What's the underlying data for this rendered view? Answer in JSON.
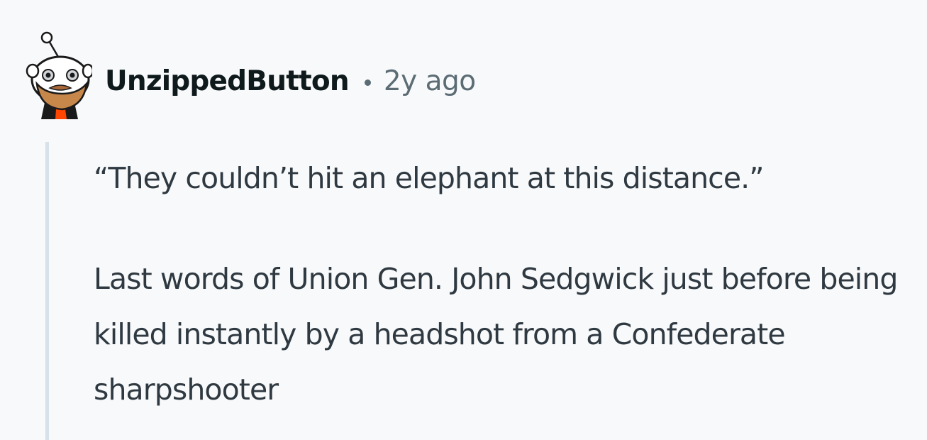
{
  "comment": {
    "author": "UnzippedButton",
    "separator": "•",
    "timestamp": "2y ago",
    "avatar_icon": "snoo-avatar-icon",
    "paragraphs": [
      "“They couldn’t hit an elephant at this distance.”",
      "Last words of Union Gen. John Sedgwick just before being killed instantly by a headshot from a Confederate sharpshooter"
    ]
  },
  "colors": {
    "background": "#f8f9fa",
    "username": "#0f1a1c",
    "meta": "#5c6c74",
    "body_text": "#2f3941",
    "thread_line": "#d7e1e7",
    "avatar_accent": "#ff4500"
  }
}
